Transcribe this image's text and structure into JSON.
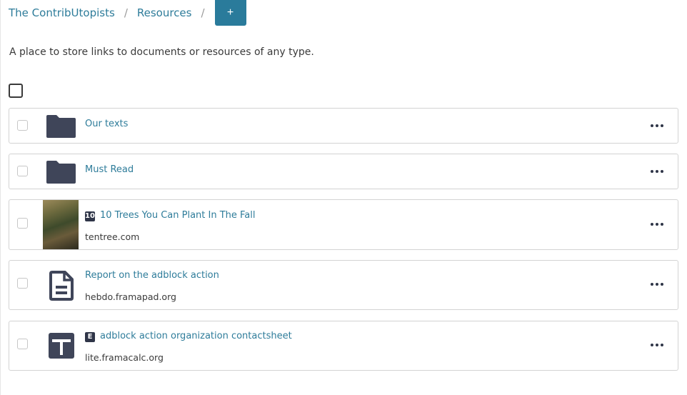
{
  "breadcrumb": {
    "group": "The ContribUtopists",
    "separator": "/",
    "page": "Resources",
    "add_label": "+"
  },
  "description": "A place to store links to documents or resources of any type.",
  "items": [
    {
      "title": "Our texts",
      "icon": "folder-icon"
    },
    {
      "title": "Must Read",
      "icon": "folder-icon"
    },
    {
      "title": "10 Trees You Can Plant In The Fall",
      "domain": "tentree.com",
      "favicon": "10",
      "icon": "link-thumbnail"
    },
    {
      "title": "Report on the adblock action",
      "domain": "hebdo.framapad.org",
      "icon": "document-icon"
    },
    {
      "title": "adblock action organization contactsheet",
      "domain": "lite.framacalc.org",
      "favicon": "E",
      "icon": "spreadsheet-icon"
    }
  ],
  "colors": {
    "accent": "#2a7b9b",
    "link": "#2e7c9a",
    "icon_dark": "#3f4559"
  }
}
